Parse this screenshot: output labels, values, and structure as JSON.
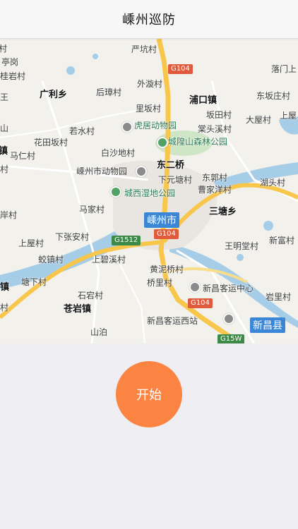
{
  "header": {
    "title": "嵊州巡防"
  },
  "map": {
    "place_labels": [
      "严坑村",
      "G104",
      "落门上",
      "亭岗",
      "桂岩村",
      "广利乡",
      "后璋村",
      "外漩村",
      "浦口镇",
      "东坂庄村",
      "里坂村",
      "坂田村",
      "大屋村",
      "上屋",
      "虎居动物园",
      "棠头溪村",
      "若水村",
      "花田坂村",
      "城隍山森林公园",
      "马仁村",
      "白沙地村",
      "东二桥",
      "嵊州市动物园",
      "下元塘村",
      "东郭村",
      "湖头村",
      "城西湿地公园",
      "曹家洋村",
      "马家村",
      "三塘乡",
      "下张安村",
      "G1512",
      "上屋村",
      "王明堂村",
      "新富村",
      "蛟镇村",
      "上碧溪村",
      "黄泥桥村",
      "桥里村",
      "新昌客运中心",
      "塘下村",
      "石宕村",
      "岩里村",
      "苍岩镇",
      "新昌客运西站",
      "山泊",
      "G15W",
      "新昌县"
    ],
    "city_badge": "嵊州市",
    "road_badge_g104_center": "G104",
    "road_badge_g104_south": "G104",
    "edge_labels": [
      "村",
      "王",
      "山",
      "镇",
      "村",
      "岸村",
      "镇",
      "村"
    ]
  },
  "actions": {
    "start_label": "开始"
  },
  "colors": {
    "accent": "#fb8443",
    "road_major": "#f7c64a",
    "water": "#a6cde8",
    "city_badge": "#3b87d6"
  }
}
